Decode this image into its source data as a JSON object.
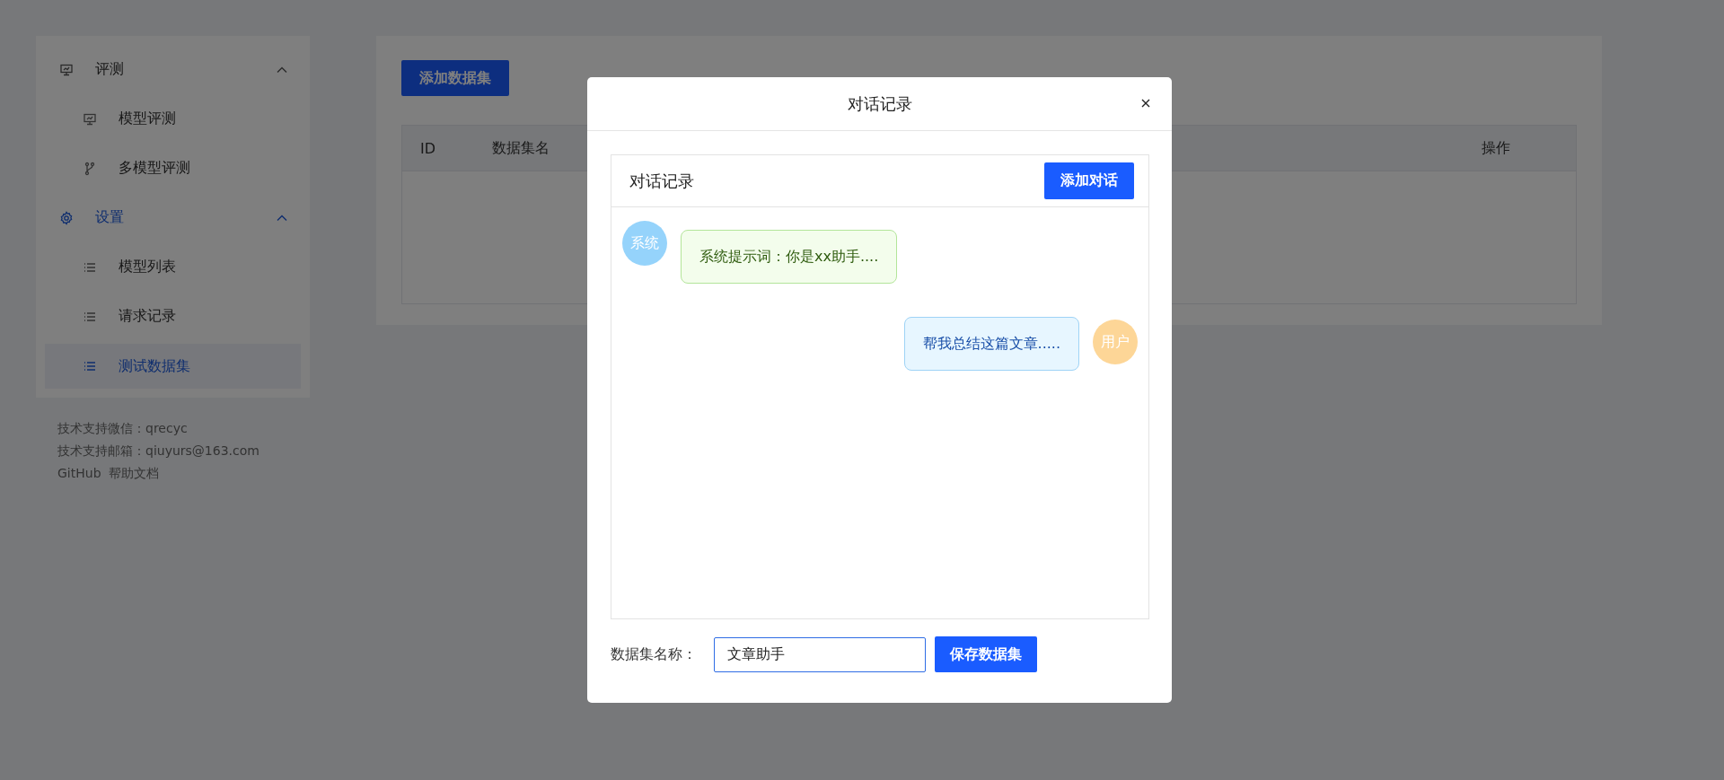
{
  "sidebar": {
    "groups": [
      {
        "label": "评测",
        "expanded": true,
        "children": [
          {
            "label": "模型评测",
            "selected": false
          },
          {
            "label": "多模型评测",
            "selected": false
          }
        ]
      },
      {
        "label": "设置",
        "expanded": true,
        "children": [
          {
            "label": "模型列表",
            "selected": false
          },
          {
            "label": "请求记录",
            "selected": false
          },
          {
            "label": "测试数据集",
            "selected": true
          }
        ]
      }
    ],
    "footer": {
      "lines": [
        "技术支持微信：qrecyc",
        "技术支持邮箱：qiuyurs@163.com"
      ],
      "links": [
        "GitHub",
        "帮助文档"
      ]
    }
  },
  "main": {
    "add_button": "添加数据集",
    "table": {
      "columns": [
        "ID",
        "数据集名",
        "操作"
      ]
    }
  },
  "modal": {
    "title": "对话记录",
    "chat": {
      "title": "对话记录",
      "add_button": "添加对话",
      "messages": [
        {
          "kind": "system",
          "avatar": "系统",
          "text": "系统提示词：你是xx助手...."
        },
        {
          "kind": "user",
          "avatar": "用户",
          "text": "帮我总结这篇文章....."
        }
      ]
    },
    "name_label": "数据集名称：",
    "name_value": "文章助手",
    "save_button": "保存数据集"
  }
}
